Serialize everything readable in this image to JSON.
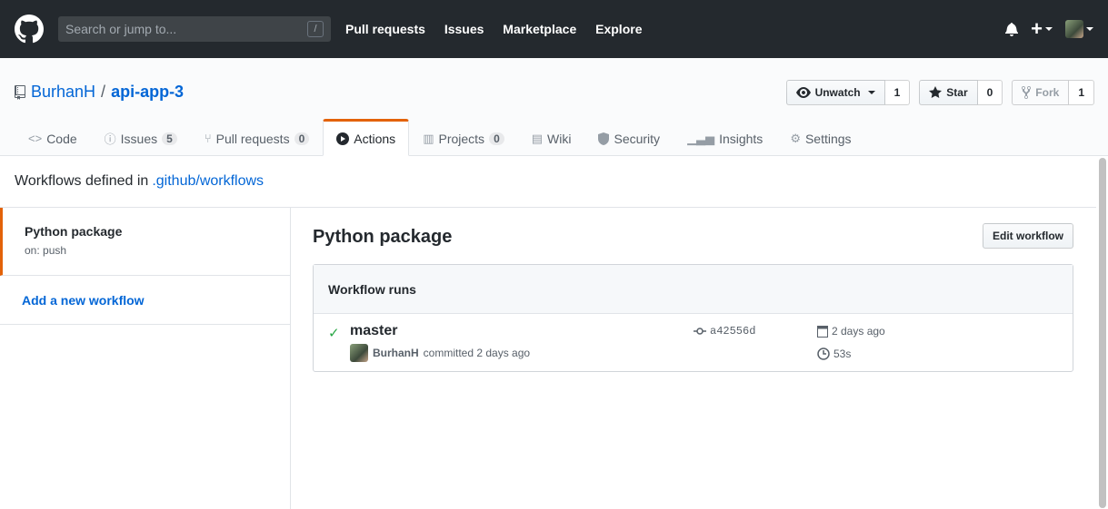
{
  "header": {
    "search_placeholder": "Search or jump to...",
    "search_shortcut": "/",
    "nav": [
      "Pull requests",
      "Issues",
      "Marketplace",
      "Explore"
    ]
  },
  "repo": {
    "owner": "BurhanH",
    "separator": "/",
    "name": "api-app-3",
    "watch_label": "Unwatch",
    "watch_count": "1",
    "star_label": "Star",
    "star_count": "0",
    "fork_label": "Fork",
    "fork_count": "1"
  },
  "tabs": [
    {
      "label": "Code",
      "icon": "code-icon"
    },
    {
      "label": "Issues",
      "count": "5",
      "icon": "issue-icon"
    },
    {
      "label": "Pull requests",
      "count": "0",
      "icon": "pull-request-icon"
    },
    {
      "label": "Actions",
      "icon": "play-icon",
      "active": true
    },
    {
      "label": "Projects",
      "count": "0",
      "icon": "project-icon"
    },
    {
      "label": "Wiki",
      "icon": "book-icon"
    },
    {
      "label": "Security",
      "icon": "shield-icon"
    },
    {
      "label": "Insights",
      "icon": "graph-icon"
    },
    {
      "label": "Settings",
      "icon": "gear-icon"
    }
  ],
  "workflows": {
    "header_text": "Workflows defined in",
    "header_path": ".github/workflows",
    "items": [
      {
        "title": "Python package",
        "trigger": "on: push"
      }
    ],
    "add_label": "Add a new workflow"
  },
  "main": {
    "title": "Python package",
    "edit_label": "Edit workflow",
    "runs_title": "Workflow runs",
    "run": {
      "branch": "master",
      "author": "BurhanH",
      "action": "committed 2 days ago",
      "sha": "a42556d",
      "date": "2 days ago",
      "duration": "53s"
    }
  },
  "colors": {
    "accent": "#e36209",
    "link": "#0366d6",
    "success": "#28a745",
    "header_bg": "#24292e"
  }
}
